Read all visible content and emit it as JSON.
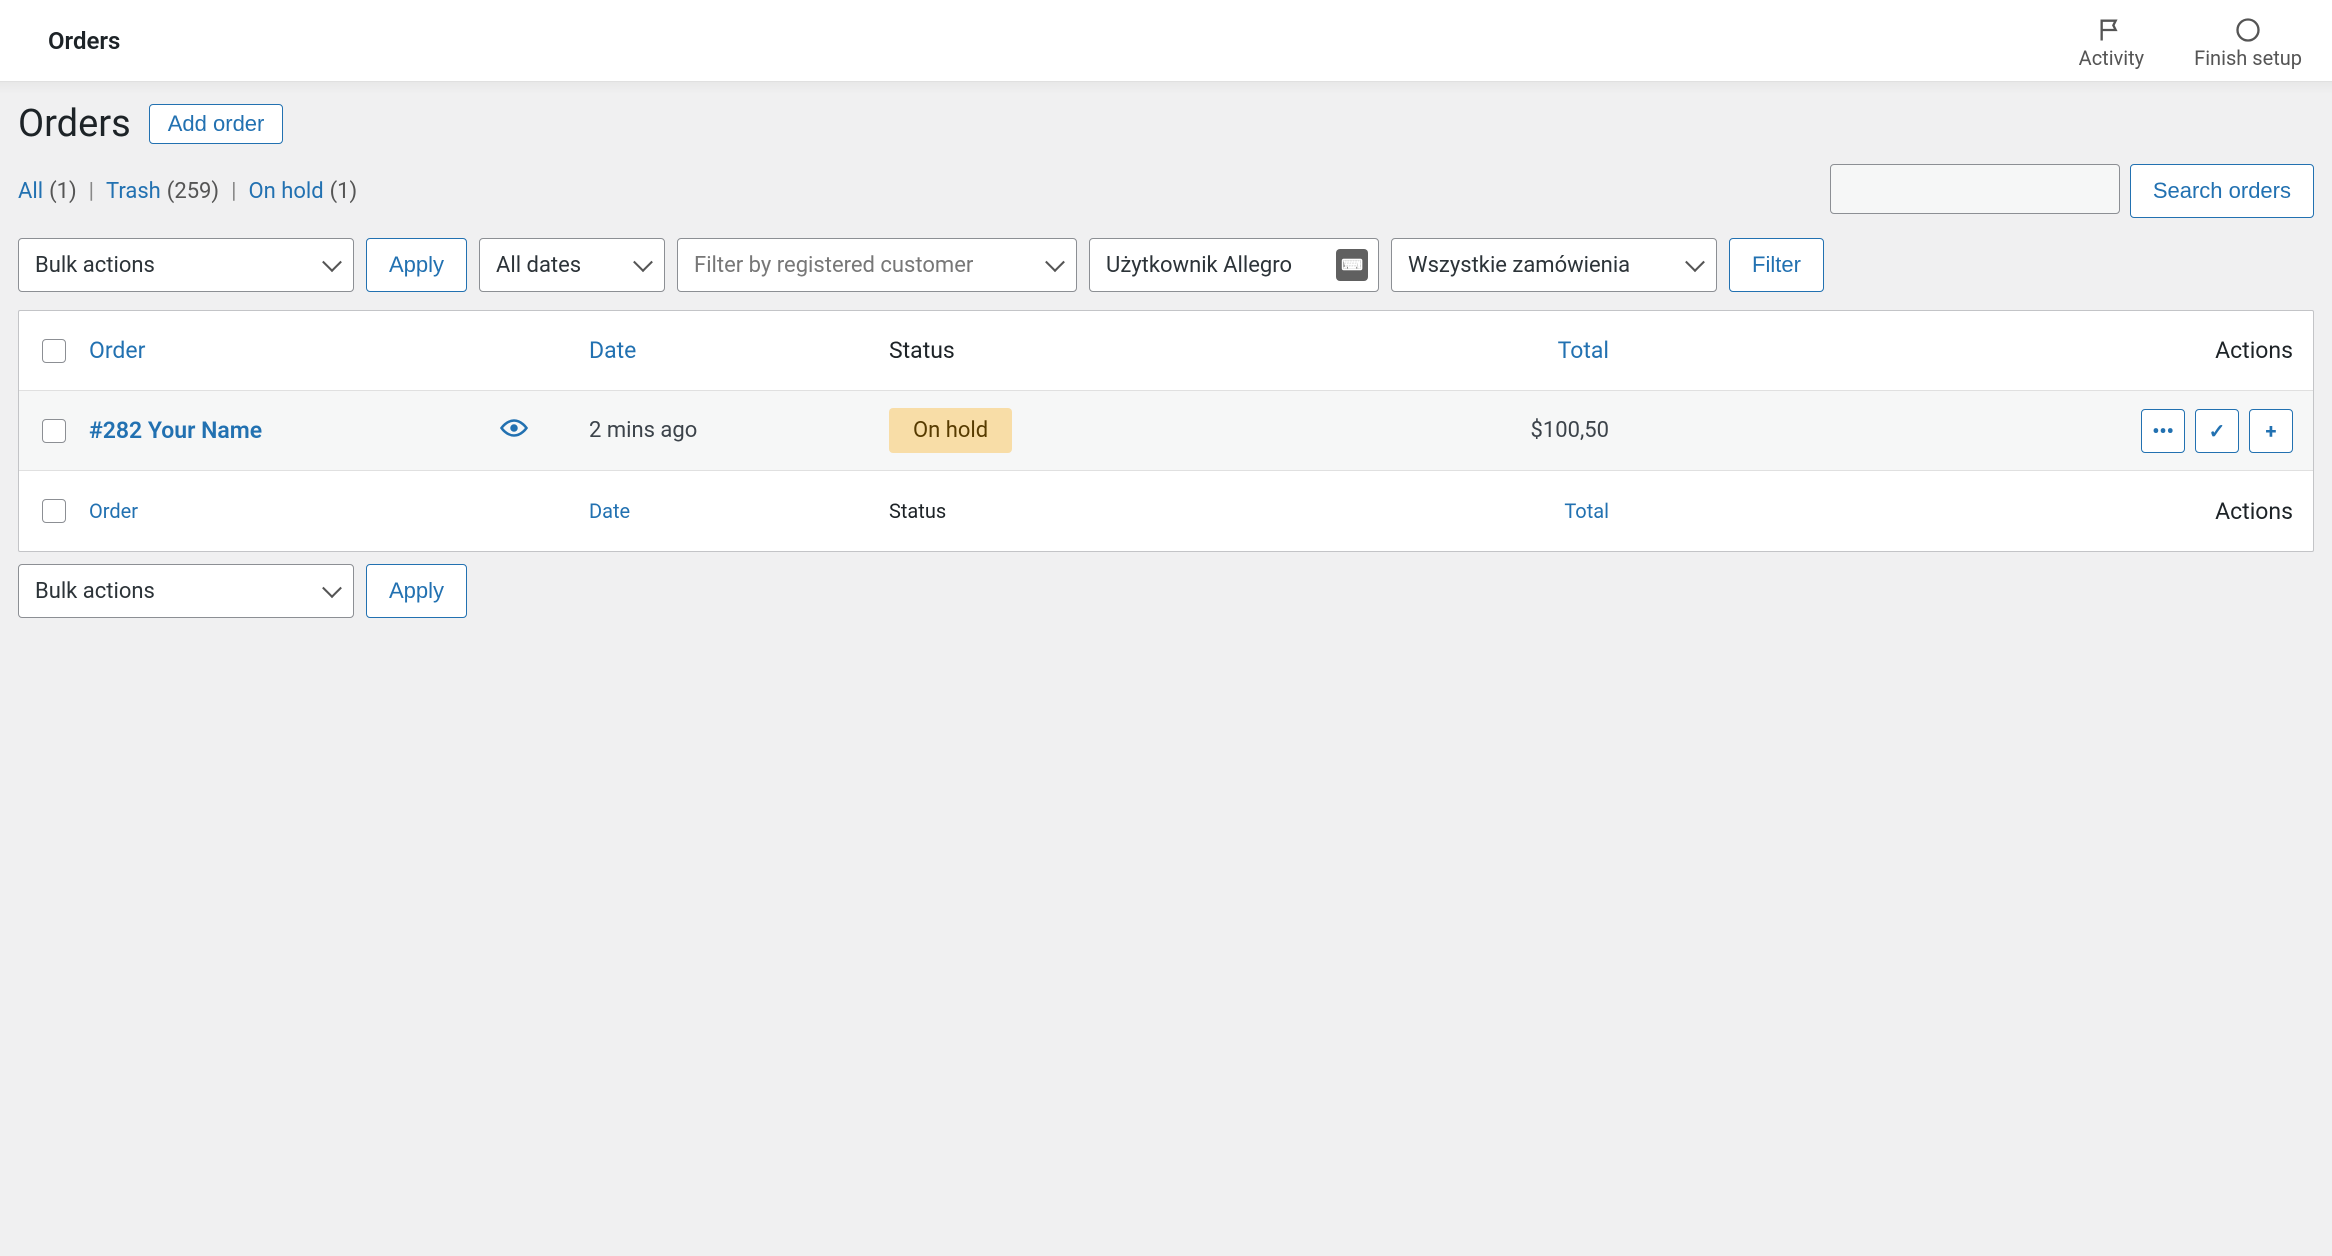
{
  "topbar": {
    "title": "Orders",
    "activity": "Activity",
    "finish_setup": "Finish setup"
  },
  "page": {
    "heading": "Orders",
    "add_order": "Add order"
  },
  "status_filters": {
    "all_label": "All",
    "all_count": "(1)",
    "trash_label": "Trash",
    "trash_count": "(259)",
    "onhold_label": "On hold",
    "onhold_count": "(1)"
  },
  "search": {
    "button": "Search orders"
  },
  "filters": {
    "bulk": "Bulk actions",
    "apply": "Apply",
    "dates": "All dates",
    "customer_placeholder": "Filter by registered customer",
    "allegro": "Użytkownik Allegro",
    "allegro_icon": "⌨",
    "orders_type": "Wszystkie zamówienia",
    "filter_btn": "Filter"
  },
  "table": {
    "col_order": "Order",
    "col_date": "Date",
    "col_status": "Status",
    "col_total": "Total",
    "col_actions": "Actions"
  },
  "rows": [
    {
      "order": "#282 Your Name",
      "date": "2 mins ago",
      "status": "On hold",
      "total": "$100,50"
    }
  ],
  "action_icons": {
    "more": "•••",
    "check": "✓",
    "plus": "+"
  }
}
